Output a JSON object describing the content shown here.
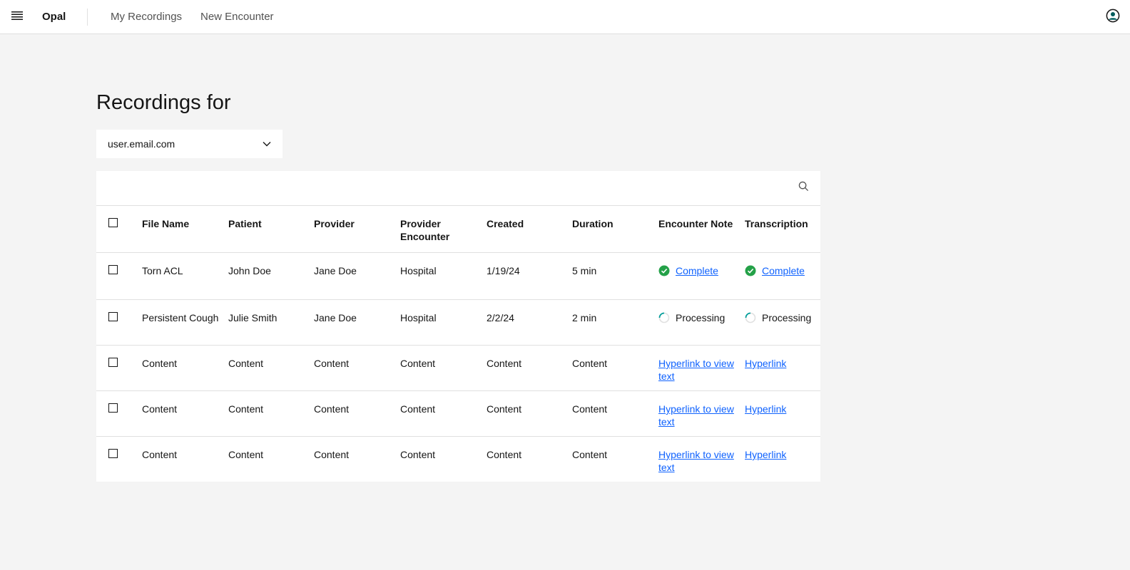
{
  "header": {
    "brand": "Opal",
    "nav": [
      "My Recordings",
      "New Encounter"
    ]
  },
  "page": {
    "title": "Recordings for",
    "account_selector": {
      "value": "user.email.com"
    }
  },
  "table": {
    "columns": [
      "File Name",
      "Patient",
      "Provider",
      "Provider Encounter",
      "Created",
      "Duration",
      "Encounter Note",
      "Transcription"
    ],
    "rows": [
      {
        "file": "Torn ACL",
        "patient": "John Doe",
        "provider": "Jane Doe",
        "provider_encounter": "Hospital",
        "created": "1/19/24",
        "duration": "5 min",
        "note": "Complete",
        "transcription": "Complete"
      },
      {
        "file": "Persistent Cough",
        "patient": "Julie Smith",
        "provider": "Jane Doe",
        "provider_encounter": "Hospital",
        "created": "2/2/24",
        "duration": "2 min",
        "note": "Processing",
        "transcription": "Processing"
      },
      {
        "file": "Content",
        "patient": "Content",
        "provider": "Content",
        "provider_encounter": "Content",
        "created": "Content",
        "duration": "Content",
        "note": "Hyperlink to view text",
        "transcription": "Hyperlink"
      },
      {
        "file": "Content",
        "patient": "Content",
        "provider": "Content",
        "provider_encounter": "Content",
        "created": "Content",
        "duration": "Content",
        "note": "Hyperlink to view text",
        "transcription": "Hyperlink"
      },
      {
        "file": "Content",
        "patient": "Content",
        "provider": "Content",
        "provider_encounter": "Content",
        "created": "Content",
        "duration": "Content",
        "note": "Hyperlink to view text",
        "transcription": "Hyperlink"
      }
    ]
  },
  "colors": {
    "link": "#0f62fe",
    "success": "#24a148",
    "spinner": "#009d9a",
    "background": "#f4f4f4"
  },
  "icons": [
    "menu-icon",
    "user-avatar-icon",
    "chevron-down-icon",
    "search-icon",
    "checkmark-filled-icon",
    "loading-spinner-icon"
  ]
}
